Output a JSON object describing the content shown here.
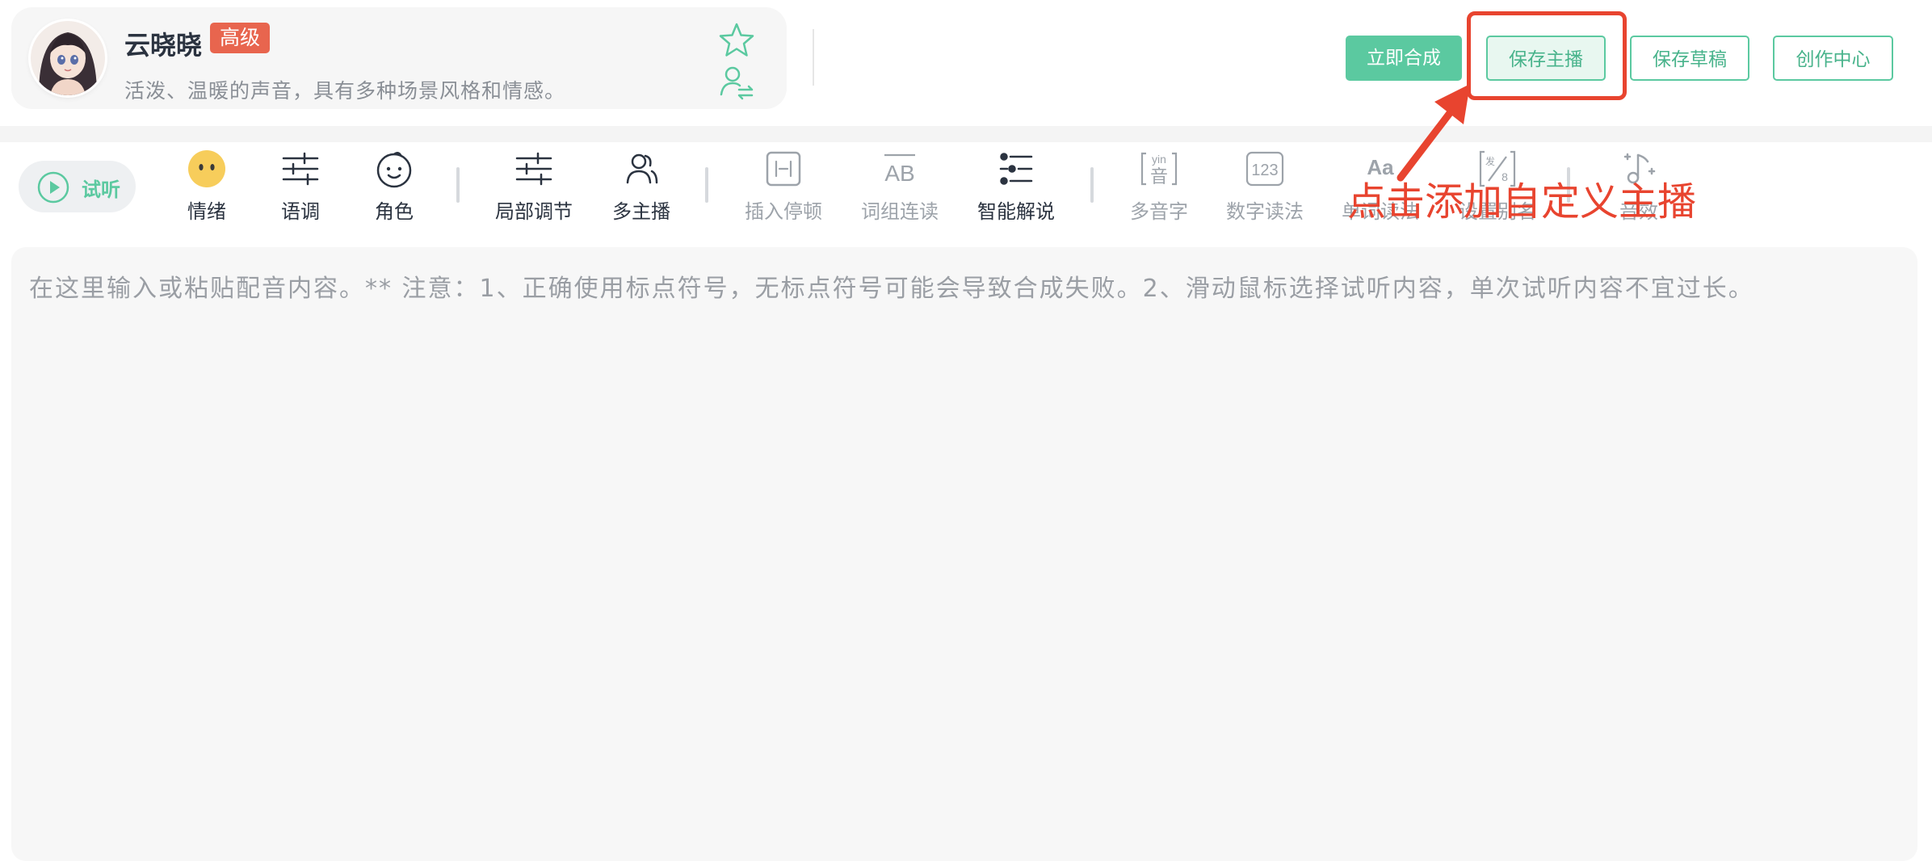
{
  "anchor": {
    "name": "云晓晓",
    "level": "高级",
    "description": "活泼、温暖的声音，具有多种场景风格和情感。",
    "icons": {
      "favorite": "star-outline-icon",
      "switch": "user-switch-icon"
    }
  },
  "header_buttons": {
    "synthesize": "立即合成",
    "save_anchor": "保存主播",
    "save_draft": "保存草稿",
    "creation_center": "创作中心"
  },
  "toolbar": {
    "preview": "试听",
    "items": [
      {
        "label": "情绪",
        "icon": "emotion-face-icon",
        "enabled": true
      },
      {
        "label": "语调",
        "icon": "sliders-icon",
        "enabled": true
      },
      {
        "label": "角色",
        "icon": "baby-face-icon",
        "enabled": true
      },
      {
        "label": "局部调节",
        "icon": "local-adjust-icon",
        "enabled": true
      },
      {
        "label": "多主播",
        "icon": "multi-user-icon",
        "enabled": true
      },
      {
        "label": "插入停顿",
        "icon": "pause-insert-icon",
        "enabled": false
      },
      {
        "label": "词组连读",
        "icon": "phrase-ab-icon",
        "enabled": false
      },
      {
        "label": "智能解说",
        "icon": "smart-narration-icon",
        "enabled": true
      },
      {
        "label": "多音字",
        "icon": "pinyin-icon",
        "enabled": false
      },
      {
        "label": "数字读法",
        "icon": "number-123-icon",
        "enabled": false
      },
      {
        "label": "单词读法",
        "icon": "word-aa-icon",
        "enabled": false
      },
      {
        "label": "设置别名",
        "icon": "alias-icon",
        "enabled": false
      },
      {
        "label": "音效",
        "icon": "sound-effect-icon",
        "enabled": false
      }
    ]
  },
  "annotation": {
    "text": "点击添加自定义主播",
    "color": "#e8442f"
  },
  "editor": {
    "placeholder": "在这里输入或粘贴配音内容。** 注意：1、正确使用标点符号，无标点符号可能会导致合成失败。2、滑动鼠标选择试听内容，单次试听内容不宜过长。"
  },
  "colors": {
    "accent": "#5bc9a0",
    "badge": "#e8654e",
    "annotation": "#e8442f"
  }
}
